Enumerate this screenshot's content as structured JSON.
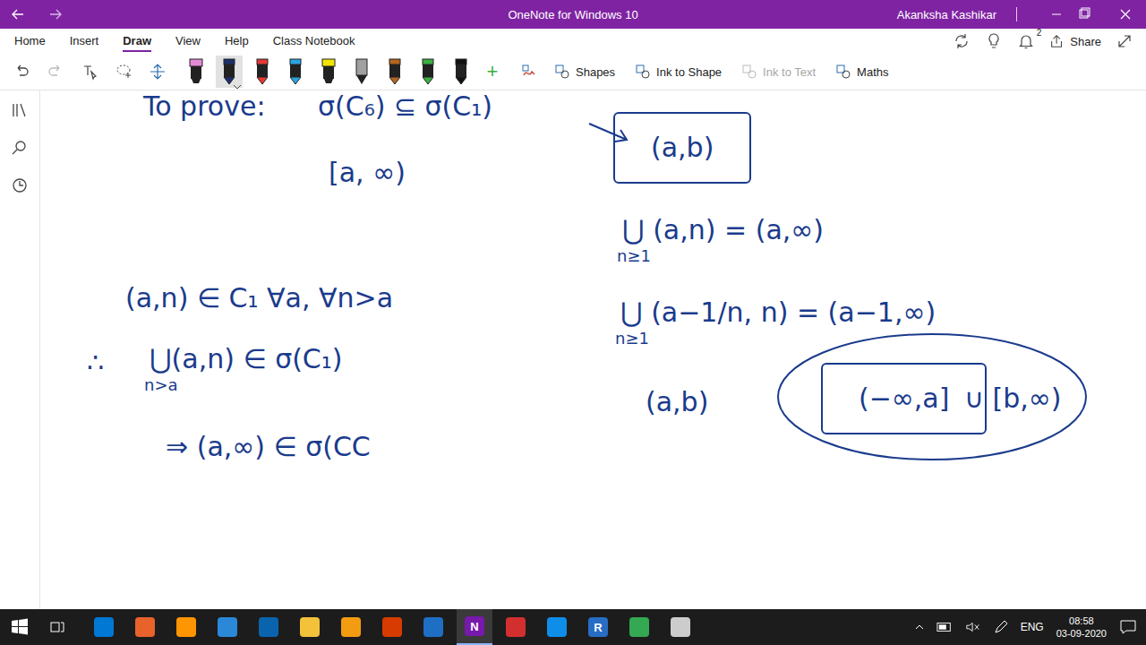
{
  "window": {
    "title": "OneNote for Windows 10",
    "user": "Akanksha Kashikar"
  },
  "menu_tabs": [
    {
      "label": "Home",
      "selected": false
    },
    {
      "label": "Insert",
      "selected": false
    },
    {
      "label": "Draw",
      "selected": true
    },
    {
      "label": "View",
      "selected": false
    },
    {
      "label": "Help",
      "selected": false
    },
    {
      "label": "Class Notebook",
      "selected": false
    }
  ],
  "header_actions": {
    "notifications": "2",
    "share": "Share"
  },
  "pens": [
    {
      "kind": "highlighter",
      "color": "#e48ad6",
      "selected": false
    },
    {
      "kind": "pen",
      "color": "#1d2f6b",
      "selected": true
    },
    {
      "kind": "pen",
      "color": "#e53935",
      "selected": false
    },
    {
      "kind": "pen",
      "color": "#2aa4e3",
      "selected": false
    },
    {
      "kind": "highlighter",
      "color": "#f2e600",
      "selected": false
    },
    {
      "kind": "pencil",
      "color": "#a0a0a0",
      "selected": false
    },
    {
      "kind": "pen",
      "color": "#b5651d",
      "selected": false
    },
    {
      "kind": "pen",
      "color": "#3cb043",
      "selected": false
    },
    {
      "kind": "pen",
      "color": "#111111",
      "selected": false
    }
  ],
  "add_pen": "+",
  "tools": [
    {
      "label": "Shapes",
      "disabled": false
    },
    {
      "label": "Ink to Shape",
      "disabled": false
    },
    {
      "label": "Ink to Text",
      "disabled": true
    },
    {
      "label": "Maths",
      "disabled": false
    }
  ],
  "strokes": [
    {
      "text": "To prove:",
      "sub": "",
      "kind": "plain"
    },
    {
      "text": "σ(C₆) ⊆ σ(C₁)",
      "sub": "",
      "kind": "plain"
    },
    {
      "text": "[a, ∞)",
      "sub": "",
      "kind": "plain"
    },
    {
      "text": "(a,n) ∈ C₁  ∀a, ∀n>a",
      "sub": "",
      "kind": "plain"
    },
    {
      "text": "∴",
      "sub": "",
      "kind": "plain"
    },
    {
      "text": "⋃(a,n) ∈ σ(C₁)",
      "sub": "n>a",
      "kind": "plain"
    },
    {
      "text": "⇒  (a,∞) ∈ σ(CC",
      "sub": "",
      "kind": "plain"
    },
    {
      "text": "(a,b)",
      "sub": "",
      "kind": "boxed"
    },
    {
      "text": "⋃ (a,n)  =  (a,∞)",
      "sub": "n≥1",
      "kind": "plain"
    },
    {
      "text": "⋃ (a−1/n, n)  =  (a−1,∞)",
      "sub": "n≥1",
      "kind": "plain"
    },
    {
      "text": "(a,b)",
      "sub": "",
      "kind": "plain"
    },
    {
      "text": "(−∞,a]",
      "sub": "",
      "kind": "boxed"
    },
    {
      "text": "∪ [b,∞)",
      "sub": "",
      "kind": "plain"
    }
  ],
  "taskbar": {
    "apps": [
      {
        "color": "#0078d4",
        "glyph": "",
        "selected": false
      },
      {
        "color": "#e8632b",
        "glyph": "",
        "selected": false
      },
      {
        "color": "#ff9500",
        "glyph": "",
        "selected": false
      },
      {
        "color": "#2b88d8",
        "glyph": "",
        "selected": false
      },
      {
        "color": "#0a64ad",
        "glyph": "",
        "selected": false
      },
      {
        "color": "#f3c13a",
        "glyph": "",
        "selected": false
      },
      {
        "color": "#f39c12",
        "glyph": "",
        "selected": false
      },
      {
        "color": "#d83b01",
        "glyph": "",
        "selected": false
      },
      {
        "color": "#1e6fc4",
        "glyph": "",
        "selected": false
      },
      {
        "color": "#7719aa",
        "glyph": "N",
        "selected": true
      },
      {
        "color": "#d32f2f",
        "glyph": "",
        "selected": false
      },
      {
        "color": "#0e8ee9",
        "glyph": "",
        "selected": false
      },
      {
        "color": "#276dc3",
        "glyph": "R",
        "selected": false
      },
      {
        "color": "#34a853",
        "glyph": "",
        "selected": false
      },
      {
        "color": "#cccccc",
        "glyph": "",
        "selected": false
      }
    ],
    "language": "ENG",
    "time": "08:58",
    "date": "03-09-2020"
  }
}
